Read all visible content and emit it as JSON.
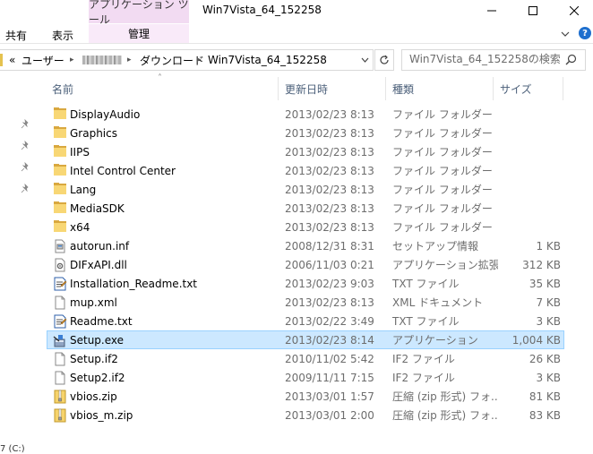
{
  "window": {
    "context_tab_header": "アプリケーション ツール",
    "title": "Win7Vista_64_152258"
  },
  "ribbon": {
    "tabs": [
      "共有",
      "表示",
      "管理"
    ]
  },
  "address": {
    "root_marker": "«",
    "crumbs": [
      "ユーザー",
      "ダウンロード",
      "Win7Vista_64_152258"
    ]
  },
  "search": {
    "placeholder": "Win7Vista_64_152258の検索"
  },
  "columns": {
    "name": "名前",
    "date": "更新日時",
    "type": "種類",
    "size": "サイズ"
  },
  "files": [
    {
      "name": "DisplayAudio",
      "date": "2013/02/23 8:13",
      "type": "ファイル フォルダー",
      "size": "",
      "icon": "folder-icon"
    },
    {
      "name": "Graphics",
      "date": "2013/02/23 8:13",
      "type": "ファイル フォルダー",
      "size": "",
      "icon": "folder-icon"
    },
    {
      "name": "IIPS",
      "date": "2013/02/23 8:13",
      "type": "ファイル フォルダー",
      "size": "",
      "icon": "folder-icon"
    },
    {
      "name": "Intel Control Center",
      "date": "2013/02/23 8:13",
      "type": "ファイル フォルダー",
      "size": "",
      "icon": "folder-icon"
    },
    {
      "name": "Lang",
      "date": "2013/02/23 8:13",
      "type": "ファイル フォルダー",
      "size": "",
      "icon": "folder-icon"
    },
    {
      "name": "MediaSDK",
      "date": "2013/02/23 8:13",
      "type": "ファイル フォルダー",
      "size": "",
      "icon": "folder-icon"
    },
    {
      "name": "x64",
      "date": "2013/02/23 8:13",
      "type": "ファイル フォルダー",
      "size": "",
      "icon": "folder-icon"
    },
    {
      "name": "autorun.inf",
      "date": "2008/12/31 8:31",
      "type": "セットアップ情報",
      "size": "1 KB",
      "icon": "setup-info-icon"
    },
    {
      "name": "DIFxAPI.dll",
      "date": "2006/11/03 0:21",
      "type": "アプリケーション拡張",
      "size": "312 KB",
      "icon": "dll-icon"
    },
    {
      "name": "Installation_Readme.txt",
      "date": "2013/02/23 9:03",
      "type": "TXT ファイル",
      "size": "35 KB",
      "icon": "text-file-icon"
    },
    {
      "name": "mup.xml",
      "date": "2013/02/23 8:13",
      "type": "XML ドキュメント",
      "size": "7 KB",
      "icon": "xml-file-icon"
    },
    {
      "name": "Readme.txt",
      "date": "2013/02/22 3:49",
      "type": "TXT ファイル",
      "size": "3 KB",
      "icon": "text-file-icon"
    },
    {
      "name": "Setup.exe",
      "date": "2013/02/23 8:14",
      "type": "アプリケーション",
      "size": "1,004 KB",
      "icon": "setup-exe-icon",
      "selected": true
    },
    {
      "name": "Setup.if2",
      "date": "2010/11/02 5:42",
      "type": "IF2 ファイル",
      "size": "26 KB",
      "icon": "generic-file-icon"
    },
    {
      "name": "Setup2.if2",
      "date": "2009/11/11 7:15",
      "type": "IF2 ファイル",
      "size": "3 KB",
      "icon": "generic-file-icon"
    },
    {
      "name": "vbios.zip",
      "date": "2013/03/01 1:57",
      "type": "圧縮 (zip 形式) フォ...",
      "size": "81 KB",
      "icon": "zip-folder-icon"
    },
    {
      "name": "vbios_m.zip",
      "date": "2013/03/01 2:00",
      "type": "圧縮 (zip 形式) フォ...",
      "size": "83 KB",
      "icon": "zip-folder-icon"
    }
  ],
  "nav": {
    "bottom_fragment": "7 (C:)"
  },
  "colors": {
    "selection_bg": "#cce8ff",
    "selection_border": "#99d1ff",
    "context_tab": "#f2dbf2",
    "header_text": "#4c607a",
    "detail_text": "#6d6d6d"
  }
}
